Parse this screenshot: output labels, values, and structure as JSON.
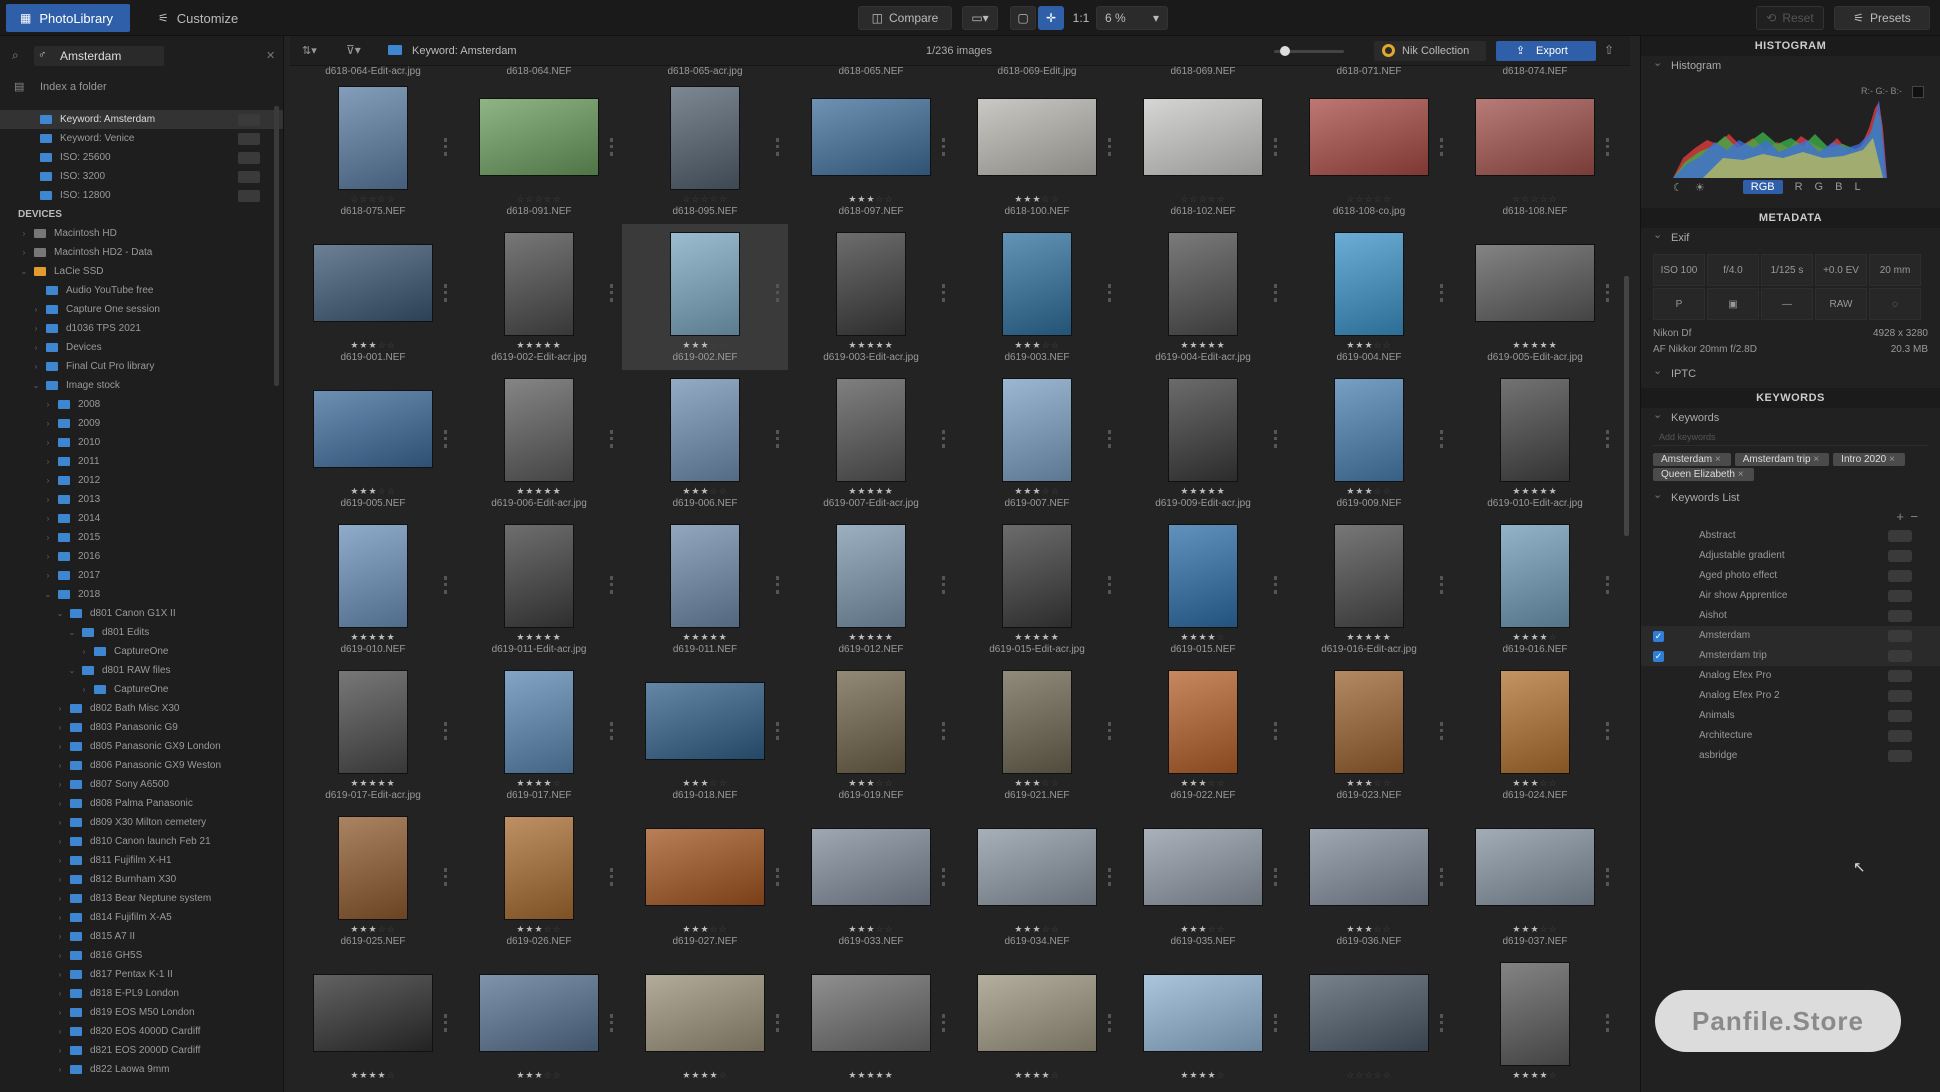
{
  "topbar": {
    "tab_library": "PhotoLibrary",
    "tab_customize": "Customize",
    "compare": "Compare",
    "ratio": "1:1",
    "zoom": "6 %",
    "reset": "Reset",
    "presets": "Presets"
  },
  "left": {
    "search_value": "Amsterdam",
    "index_label": "Index a folder",
    "keywords": [
      {
        "label": "Keyword: Amsterdam",
        "selected": true
      },
      {
        "label": "Keyword: Venice"
      },
      {
        "label": "ISO: 25600"
      },
      {
        "label": "ISO: 3200"
      },
      {
        "label": "ISO: 12800"
      }
    ],
    "devices_label": "DEVICES",
    "tree": [
      {
        "label": "Macintosh HD",
        "indent": 1,
        "icon": "grey",
        "caret": "›"
      },
      {
        "label": "Macintosh HD2 - Data",
        "indent": 1,
        "icon": "grey",
        "caret": "›"
      },
      {
        "label": "LaCie SSD",
        "indent": 1,
        "icon": "orange",
        "caret": "⌄"
      },
      {
        "label": "Audio YouTube free",
        "indent": 2,
        "caret": ""
      },
      {
        "label": "Capture One session",
        "indent": 2,
        "caret": "›"
      },
      {
        "label": "d1036 TPS 2021",
        "indent": 2,
        "caret": "›"
      },
      {
        "label": "Devices",
        "indent": 2,
        "caret": "›"
      },
      {
        "label": "Final Cut Pro library",
        "indent": 2,
        "caret": "›"
      },
      {
        "label": "Image stock",
        "indent": 2,
        "caret": "⌄"
      },
      {
        "label": "2008",
        "indent": 3,
        "caret": "›"
      },
      {
        "label": "2009",
        "indent": 3,
        "caret": "›"
      },
      {
        "label": "2010",
        "indent": 3,
        "caret": "›"
      },
      {
        "label": "2011",
        "indent": 3,
        "caret": "›"
      },
      {
        "label": "2012",
        "indent": 3,
        "caret": "›"
      },
      {
        "label": "2013",
        "indent": 3,
        "caret": "›"
      },
      {
        "label": "2014",
        "indent": 3,
        "caret": "›"
      },
      {
        "label": "2015",
        "indent": 3,
        "caret": "›"
      },
      {
        "label": "2016",
        "indent": 3,
        "caret": "›"
      },
      {
        "label": "2017",
        "indent": 3,
        "caret": "›"
      },
      {
        "label": "2018",
        "indent": 3,
        "caret": "⌄"
      },
      {
        "label": "d801 Canon G1X II",
        "indent": 4,
        "caret": "⌄"
      },
      {
        "label": "d801 Edits",
        "indent": 5,
        "caret": "⌄"
      },
      {
        "label": "CaptureOne",
        "indent": 6,
        "caret": "›"
      },
      {
        "label": "d801 RAW files",
        "indent": 5,
        "caret": "⌄"
      },
      {
        "label": "CaptureOne",
        "indent": 6,
        "caret": "›"
      },
      {
        "label": "d802 Bath Misc X30",
        "indent": 4,
        "caret": "›"
      },
      {
        "label": "d803 Panasonic G9",
        "indent": 4,
        "caret": "›"
      },
      {
        "label": "d805 Panasonic GX9 London",
        "indent": 4,
        "caret": "›"
      },
      {
        "label": "d806 Panasonic GX9 Weston",
        "indent": 4,
        "caret": "›"
      },
      {
        "label": "d807 Sony A6500",
        "indent": 4,
        "caret": "›"
      },
      {
        "label": "d808 Palma Panasonic",
        "indent": 4,
        "caret": "›"
      },
      {
        "label": "d809 X30 Milton cemetery",
        "indent": 4,
        "caret": "›"
      },
      {
        "label": "d810 Canon launch Feb 21",
        "indent": 4,
        "caret": "›"
      },
      {
        "label": "d811 Fujifilm X-H1",
        "indent": 4,
        "caret": "›"
      },
      {
        "label": "d812 Burnham X30",
        "indent": 4,
        "caret": "›"
      },
      {
        "label": "d813 Bear Neptune system",
        "indent": 4,
        "caret": "›"
      },
      {
        "label": "d814 Fujifilm X-A5",
        "indent": 4,
        "caret": "›"
      },
      {
        "label": "d815 A7 II",
        "indent": 4,
        "caret": "›"
      },
      {
        "label": "d816 GH5S",
        "indent": 4,
        "caret": "›"
      },
      {
        "label": "d817 Pentax K-1 II",
        "indent": 4,
        "caret": "›"
      },
      {
        "label": "d818 E-PL9 London",
        "indent": 4,
        "caret": "›"
      },
      {
        "label": "d819 EOS M50 London",
        "indent": 4,
        "caret": "›"
      },
      {
        "label": "d820 EOS 4000D Cardiff",
        "indent": 4,
        "caret": "›"
      },
      {
        "label": "d821 EOS 2000D Cardiff",
        "indent": 4,
        "caret": "›"
      },
      {
        "label": "d822 Laowa 9mm",
        "indent": 4,
        "caret": "›"
      }
    ]
  },
  "center": {
    "keyword_crumb": "Keyword: Amsterdam",
    "count": "1/236 images",
    "nik": "Nik Collection",
    "export": "Export",
    "top_partial": [
      "d618-064-Edit-acr.jpg",
      "d618-064.NEF",
      "d618-065-acr.jpg",
      "d618-065.NEF",
      "d618-069-Edit.jpg",
      "d618-069.NEF",
      "d618-071.NEF",
      "d618-074.NEF"
    ],
    "rows": [
      [
        {
          "name": "d618-075.NEF",
          "stars": 0,
          "color": "#5b7da3",
          "shape": "portrait"
        },
        {
          "name": "d618-091.NEF",
          "stars": 0,
          "color": "#6a9b5c",
          "shape": "landscape"
        },
        {
          "name": "d618-095.NEF",
          "stars": 0,
          "color": "#52606e",
          "shape": "portrait"
        },
        {
          "name": "d618-097.NEF",
          "stars": 3,
          "color": "#3f6e9a",
          "shape": "landscape"
        },
        {
          "name": "d618-100.NEF",
          "stars": 3,
          "color": "#b8b6b0",
          "shape": "landscape"
        },
        {
          "name": "d618-102.NEF",
          "stars": 0,
          "color": "#c8c8c6",
          "shape": "landscape"
        },
        {
          "name": "d618-108-co.jpg",
          "stars": 0,
          "color": "#a84a44",
          "shape": "landscape"
        },
        {
          "name": "d618-108.NEF",
          "stars": 0,
          "color": "#a0504a",
          "shape": "landscape"
        }
      ],
      [
        {
          "name": "d619-001.NEF",
          "stars": 3,
          "color": "#3b5672",
          "shape": "landscape"
        },
        {
          "name": "d619-002-Edit-acr.jpg",
          "stars": 5,
          "color": "#4a4a4a",
          "shape": "portrait"
        },
        {
          "name": "d619-002.NEF",
          "stars": 3,
          "color": "#7aa6bf",
          "shape": "portrait",
          "selected": true
        },
        {
          "name": "d619-003-Edit-acr.jpg",
          "stars": 5,
          "color": "#3c3c3c",
          "shape": "portrait"
        },
        {
          "name": "d619-003.NEF",
          "stars": 3,
          "color": "#2f6f9c",
          "shape": "portrait"
        },
        {
          "name": "d619-004-Edit-acr.jpg",
          "stars": 5,
          "color": "#4e4e4e",
          "shape": "portrait"
        },
        {
          "name": "d619-004.NEF",
          "stars": 3,
          "color": "#3b92c8",
          "shape": "portrait"
        },
        {
          "name": "d619-005-Edit-acr.jpg",
          "stars": 5,
          "color": "#5a5a5a",
          "shape": "landscape"
        }
      ],
      [
        {
          "name": "d619-005.NEF",
          "stars": 3,
          "color": "#3d6a99",
          "shape": "landscape"
        },
        {
          "name": "d619-006-Edit-acr.jpg",
          "stars": 5,
          "color": "#5c5c5c",
          "shape": "portrait"
        },
        {
          "name": "d619-006.NEF",
          "stars": 3,
          "color": "#6f8fb0",
          "shape": "portrait"
        },
        {
          "name": "d619-007-Edit-acr.jpg",
          "stars": 5,
          "color": "#555555",
          "shape": "portrait"
        },
        {
          "name": "d619-007.NEF",
          "stars": 3,
          "color": "#7b9fc2",
          "shape": "portrait"
        },
        {
          "name": "d619-009-Edit-acr.jpg",
          "stars": 5,
          "color": "#3a3a3a",
          "shape": "portrait"
        },
        {
          "name": "d619-009.NEF",
          "stars": 3,
          "color": "#4a7fb0",
          "shape": "portrait"
        },
        {
          "name": "d619-010-Edit-acr.jpg",
          "stars": 5,
          "color": "#444444",
          "shape": "portrait"
        }
      ],
      [
        {
          "name": "d619-010.NEF",
          "stars": 5,
          "color": "#6a90b8",
          "shape": "portrait"
        },
        {
          "name": "d619-011-Edit-acr.jpg",
          "stars": 5,
          "color": "#3e3e3e",
          "shape": "portrait"
        },
        {
          "name": "d619-011.NEF",
          "stars": 5,
          "color": "#6e8aa8",
          "shape": "portrait"
        },
        {
          "name": "d619-012.NEF",
          "stars": 5,
          "color": "#7b95ad",
          "shape": "portrait"
        },
        {
          "name": "d619-015-Edit-acr.jpg",
          "stars": 5,
          "color": "#3b3b3b",
          "shape": "portrait"
        },
        {
          "name": "d619-015.NEF",
          "stars": 4,
          "color": "#2c6ea8",
          "shape": "portrait"
        },
        {
          "name": "d619-016-Edit-acr.jpg",
          "stars": 5,
          "color": "#4a4a4a",
          "shape": "portrait"
        },
        {
          "name": "d619-016.NEF",
          "stars": 4,
          "color": "#6f9ab6",
          "shape": "portrait"
        }
      ],
      [
        {
          "name": "d619-017-Edit-acr.jpg",
          "stars": 5,
          "color": "#4a4a4a",
          "shape": "portrait"
        },
        {
          "name": "d619-017.NEF",
          "stars": 4,
          "color": "#5b86b3",
          "shape": "portrait"
        },
        {
          "name": "d619-018.NEF",
          "stars": 3,
          "color": "#2f5f86",
          "shape": "landscape"
        },
        {
          "name": "d619-019.NEF",
          "stars": 3,
          "color": "#6e6248",
          "shape": "portrait"
        },
        {
          "name": "d619-021.NEF",
          "stars": 3,
          "color": "#6b6550",
          "shape": "portrait"
        },
        {
          "name": "d619-022.NEF",
          "stars": 3,
          "color": "#b4602a",
          "shape": "portrait"
        },
        {
          "name": "d619-023.NEF",
          "stars": 3,
          "color": "#9a6230",
          "shape": "portrait"
        },
        {
          "name": "d619-024.NEF",
          "stars": 3,
          "color": "#b0702e",
          "shape": "portrait"
        }
      ],
      [
        {
          "name": "d619-025.NEF",
          "stars": 3,
          "color": "#8e5a2e",
          "shape": "portrait"
        },
        {
          "name": "d619-026.NEF",
          "stars": 3,
          "color": "#a86c30",
          "shape": "portrait"
        },
        {
          "name": "d619-027.NEF",
          "stars": 3,
          "color": "#a2541f",
          "shape": "landscape"
        },
        {
          "name": "d619-033.NEF",
          "stars": 3,
          "color": "#7e8a99",
          "shape": "landscape"
        },
        {
          "name": "d619-034.NEF",
          "stars": 3,
          "color": "#8a95a2",
          "shape": "landscape"
        },
        {
          "name": "d619-035.NEF",
          "stars": 3,
          "color": "#8d97a3",
          "shape": "landscape"
        },
        {
          "name": "d619-036.NEF",
          "stars": 3,
          "color": "#7f8b99",
          "shape": "landscape"
        },
        {
          "name": "d619-037.NEF",
          "stars": 3,
          "color": "#8391a0",
          "shape": "landscape"
        }
      ],
      [
        {
          "name": "",
          "stars": 4,
          "color": "#2e2e2e",
          "shape": "landscape"
        },
        {
          "name": "",
          "stars": 3,
          "color": "#55708e",
          "shape": "landscape"
        },
        {
          "name": "",
          "stars": 4,
          "color": "#9a9078",
          "shape": "landscape"
        },
        {
          "name": "",
          "stars": 5,
          "color": "#6a6a6a",
          "shape": "landscape"
        },
        {
          "name": "",
          "stars": 4,
          "color": "#9b947e",
          "shape": "landscape"
        },
        {
          "name": "",
          "stars": 4,
          "color": "#8fb2d2",
          "shape": "landscape"
        },
        {
          "name": "",
          "stars": 0,
          "color": "#4b5867",
          "shape": "landscape"
        },
        {
          "name": "",
          "stars": 4,
          "color": "#5a5a5a",
          "shape": "portrait"
        }
      ]
    ]
  },
  "right": {
    "histogram_head": "HISTOGRAM",
    "histogram_sub": "Histogram",
    "rgb_readout": "R:- G:- B:-",
    "channels": [
      "RGB",
      "R",
      "G",
      "B",
      "L"
    ],
    "metadata_head": "METADATA",
    "exif_sub": "Exif",
    "exif": [
      "ISO 100",
      "f/4.0",
      "1/125 s",
      "+0.0 EV",
      "20 mm"
    ],
    "exif2": [
      "P",
      "▣",
      "—",
      "RAW",
      "◌"
    ],
    "camera": "Nikon Df",
    "dims": "4928 x 3280",
    "lens": "AF Nikkor 20mm f/2.8D",
    "size": "20.3 MB",
    "iptc_sub": "IPTC",
    "keywords_head": "KEYWORDS",
    "keywords_sub": "Keywords",
    "add_keywords": "Add keywords",
    "chips": [
      "Amsterdam",
      "Amsterdam trip",
      "Intro 2020",
      "Queen Elizabeth"
    ],
    "list_sub": "Keywords List",
    "list": [
      {
        "label": "Abstract",
        "checked": false
      },
      {
        "label": "Adjustable gradient",
        "checked": false
      },
      {
        "label": "Aged photo effect",
        "checked": false
      },
      {
        "label": "Air show Apprentice",
        "checked": false
      },
      {
        "label": "Aishot",
        "checked": false
      },
      {
        "label": "Amsterdam",
        "checked": true
      },
      {
        "label": "Amsterdam trip",
        "checked": true
      },
      {
        "label": "Analog Efex Pro",
        "checked": false
      },
      {
        "label": "Analog Efex Pro 2",
        "checked": false
      },
      {
        "label": "Animals",
        "checked": false
      },
      {
        "label": "Architecture",
        "checked": false
      },
      {
        "label": "asbridge",
        "checked": false
      }
    ]
  },
  "watermark": "Panfile.Store"
}
